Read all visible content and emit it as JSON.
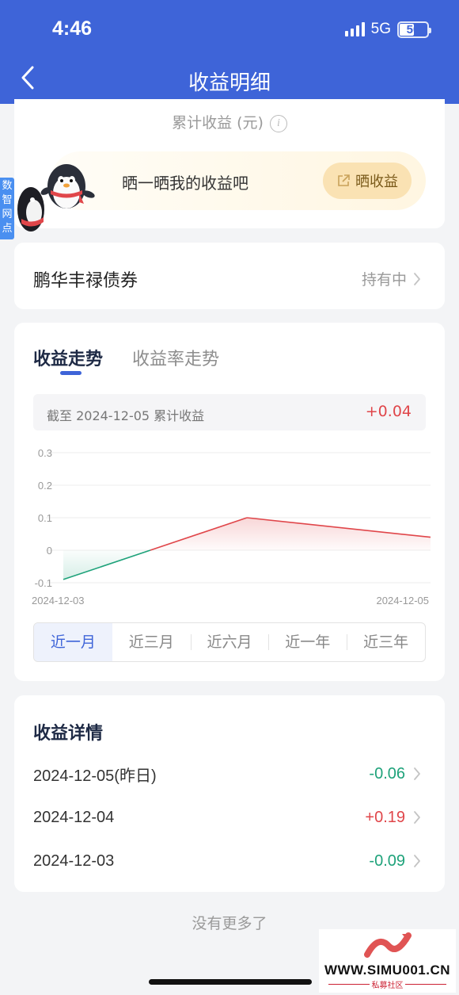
{
  "status_bar": {
    "time": "4:46",
    "network": "5G",
    "battery": "50"
  },
  "nav": {
    "title": "收益明细"
  },
  "summary_card": {
    "cumulative_label": "累计收益 (元)",
    "share_text": "晒一晒我的收益吧",
    "share_button": "晒收益"
  },
  "side_tag": {
    "label": "数智网点"
  },
  "product": {
    "name": "鹏华丰禄债券",
    "status": "持有中"
  },
  "trend": {
    "tabs": [
      {
        "label": "收益走势",
        "active": true
      },
      {
        "label": "收益率走势",
        "active": false
      }
    ],
    "summary_label": "截至 2024-12-05 累计收益",
    "summary_value": "+0.04",
    "periods": [
      {
        "label": "近一月",
        "active": true
      },
      {
        "label": "近三月",
        "active": false
      },
      {
        "label": "近六月",
        "active": false
      },
      {
        "label": "近一年",
        "active": false
      },
      {
        "label": "近三年",
        "active": false
      }
    ]
  },
  "chart_data": {
    "type": "line",
    "x": [
      "2024-12-03",
      "2024-12-04",
      "2024-12-05"
    ],
    "x_tick_labels": [
      "2024-12-03",
      "2024-12-05"
    ],
    "y_ticks": [
      "0.3",
      "0.2",
      "0.1",
      "0",
      "-0.1"
    ],
    "ylim": [
      -0.1,
      0.3
    ],
    "series": [
      {
        "values": [
          -0.09,
          0.1,
          0.04
        ]
      }
    ],
    "colors": {
      "positive": "#e0464a",
      "negative": "#1ea27a",
      "grid": "#ececec"
    },
    "grid": true
  },
  "details": {
    "title": "收益详情",
    "rows": [
      {
        "date": "2024-12-05(昨日)",
        "value": "-0.06",
        "sign": "negative"
      },
      {
        "date": "2024-12-04",
        "value": "+0.19",
        "sign": "positive"
      },
      {
        "date": "2024-12-03",
        "value": "-0.09",
        "sign": "negative"
      }
    ]
  },
  "footer": {
    "no_more": "没有更多了"
  },
  "watermark": {
    "site": "WWW.SIMU001.CN",
    "sub": "私募社区"
  },
  "colors": {
    "brand": "#3e64d8",
    "positive": "#e0464a",
    "negative": "#1ea27a"
  }
}
